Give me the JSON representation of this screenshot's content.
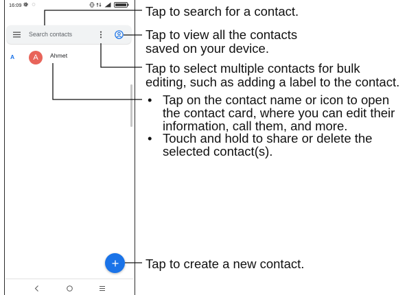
{
  "status_bar": {
    "time": "16:09",
    "left_icons": [
      "gear-icon",
      "notification-dot-icon"
    ],
    "right_icons": [
      "vibrate-icon",
      "network-icon",
      "signal-icon",
      "battery-icon"
    ]
  },
  "search": {
    "placeholder": "Search contacts",
    "menu_icon": "hamburger-menu-icon",
    "more_icon": "more-vert-icon",
    "account_icon": "account-circle-icon"
  },
  "contacts": {
    "section_letter": "A",
    "items": [
      {
        "initial": "A",
        "name": "Ahmet",
        "avatar_color": "#e8645a"
      }
    ]
  },
  "fab": {
    "icon": "plus-icon",
    "color": "#1a73e8"
  },
  "nav_bar": {
    "icons": [
      "back-icon",
      "home-icon",
      "recents-icon"
    ]
  },
  "annotations": {
    "search": [
      "Tap to search for a contact."
    ],
    "account": [
      "Tap to view all the contacts",
      "saved on your device."
    ],
    "select": [
      "Tap to select multiple contacts for bulk",
      "editing, such as adding a label to the contact."
    ],
    "contact": [
      [
        "Tap on the contact name or icon to open",
        "the contact card, where you can edit their",
        "information, call them, and more."
      ],
      [
        "Touch and hold to share or delete the",
        "selected contact(s)."
      ]
    ],
    "create": [
      "Tap to create a new contact."
    ]
  },
  "colors": {
    "accent": "#1a73e8",
    "search_bg": "#f1f3f4",
    "avatar": "#e8645a",
    "frame": "#2a2a2a"
  }
}
